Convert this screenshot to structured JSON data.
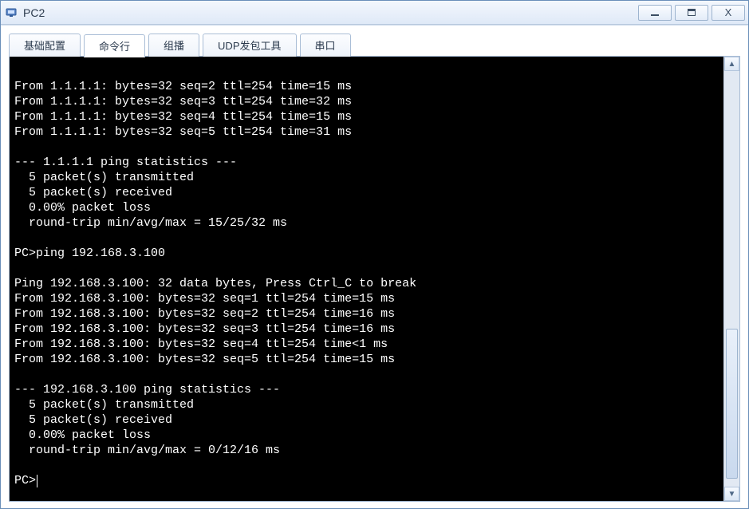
{
  "window": {
    "title": "PC2",
    "buttons": {
      "min": "_",
      "max": "□",
      "close": "X"
    }
  },
  "tabs": [
    {
      "id": "basic",
      "label": "基础配置"
    },
    {
      "id": "cmd",
      "label": "命令行"
    },
    {
      "id": "mcast",
      "label": "组播"
    },
    {
      "id": "udp",
      "label": "UDP发包工具"
    },
    {
      "id": "serial",
      "label": "串口"
    }
  ],
  "active_tab": "cmd",
  "terminal_lines": [
    "From 1.1.1.1: bytes=32 seq=2 ttl=254 time=15 ms",
    "From 1.1.1.1: bytes=32 seq=3 ttl=254 time=32 ms",
    "From 1.1.1.1: bytes=32 seq=4 ttl=254 time=15 ms",
    "From 1.1.1.1: bytes=32 seq=5 ttl=254 time=31 ms",
    "",
    "--- 1.1.1.1 ping statistics ---",
    "  5 packet(s) transmitted",
    "  5 packet(s) received",
    "  0.00% packet loss",
    "  round-trip min/avg/max = 15/25/32 ms",
    "",
    "PC>ping 192.168.3.100",
    "",
    "Ping 192.168.3.100: 32 data bytes, Press Ctrl_C to break",
    "From 192.168.3.100: bytes=32 seq=1 ttl=254 time=15 ms",
    "From 192.168.3.100: bytes=32 seq=2 ttl=254 time=16 ms",
    "From 192.168.3.100: bytes=32 seq=3 ttl=254 time=16 ms",
    "From 192.168.3.100: bytes=32 seq=4 ttl=254 time<1 ms",
    "From 192.168.3.100: bytes=32 seq=5 ttl=254 time=15 ms",
    "",
    "--- 192.168.3.100 ping statistics ---",
    "  5 packet(s) transmitted",
    "  5 packet(s) received",
    "  0.00% packet loss",
    "  round-trip min/avg/max = 0/12/16 ms",
    ""
  ],
  "prompt": "PC>",
  "scrollbar": {
    "thumb_top_pct": 62,
    "thumb_height_pct": 36
  }
}
